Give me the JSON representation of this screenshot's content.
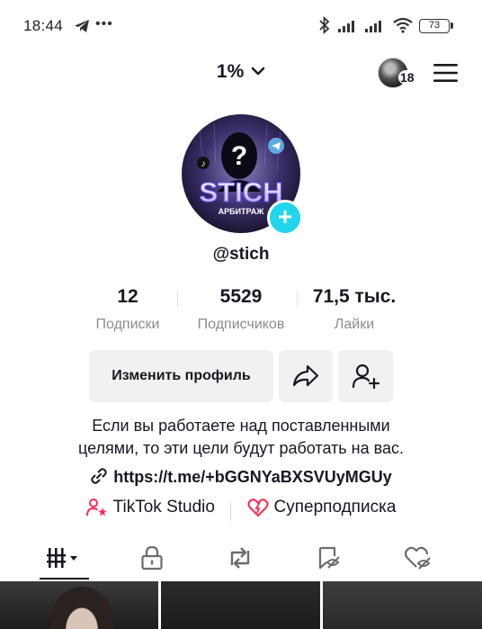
{
  "status_bar": {
    "time": "18:44",
    "battery": "73",
    "icons": [
      "telegram-icon",
      "more-dots-icon",
      "bluetooth-icon",
      "signal-icon",
      "signal-icon",
      "wifi-icon",
      "battery-icon"
    ]
  },
  "header": {
    "title": "1%",
    "friends_count": "18"
  },
  "profile": {
    "avatar_text": "STICH",
    "avatar_subtext": "АРБИТРАЖ",
    "username": "@stich",
    "stats": [
      {
        "value": "12",
        "label": "Подписки"
      },
      {
        "value": "5529",
        "label": "Подписчиков"
      },
      {
        "value": "71,5 тыс.",
        "label": "Лайки"
      }
    ],
    "edit_button": "Изменить профиль",
    "bio_line1": "Если вы работаете над поставленными",
    "bio_line2": "целями, то эти цели будут работать на вас.",
    "link": "https://t.me/+bGGNYaBXSVUyMGUy",
    "shortcut_studio": "TikTok Studio",
    "shortcut_subscription": "Суперподписка"
  },
  "colors": {
    "accent": "#20d5ec",
    "brand_pink": "#fe2c55",
    "text": "#161823",
    "muted": "#8a8b91"
  }
}
